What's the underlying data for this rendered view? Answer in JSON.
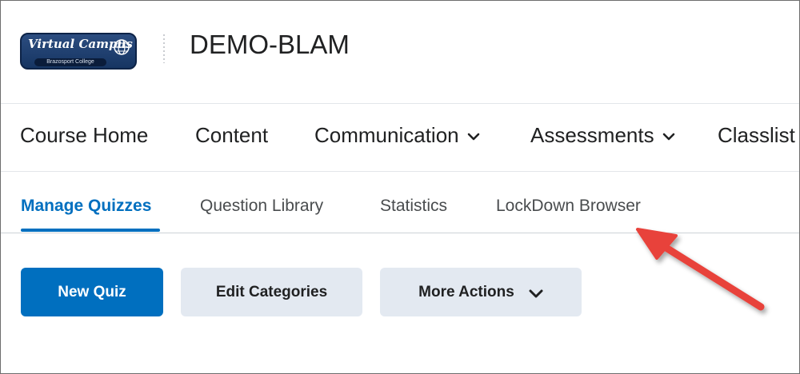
{
  "header": {
    "logo": {
      "main_text": "Virtual Campus",
      "sub_text": "Brazosport College"
    },
    "course_title": "DEMO-BLAM"
  },
  "nav": {
    "items": [
      {
        "label": "Course Home",
        "has_dropdown": false
      },
      {
        "label": "Content",
        "has_dropdown": false
      },
      {
        "label": "Communication",
        "has_dropdown": true
      },
      {
        "label": "Assessments",
        "has_dropdown": true
      },
      {
        "label": "Classlist",
        "has_dropdown": false
      }
    ]
  },
  "tabs": {
    "items": [
      {
        "label": "Manage Quizzes",
        "active": true
      },
      {
        "label": "Question Library",
        "active": false
      },
      {
        "label": "Statistics",
        "active": false
      },
      {
        "label": "LockDown Browser",
        "active": false
      }
    ]
  },
  "actions": {
    "new_quiz": "New Quiz",
    "edit_categories": "Edit Categories",
    "more_actions": "More Actions"
  },
  "icons": {
    "dropdown": "chevron-down-icon",
    "logo_globe": "globe-icon",
    "annotation": "red-arrow-pointer"
  },
  "colors": {
    "accent": "#006fbf",
    "secondary_button_bg": "#e3e9f1",
    "annotation_arrow": "#e8433b"
  }
}
